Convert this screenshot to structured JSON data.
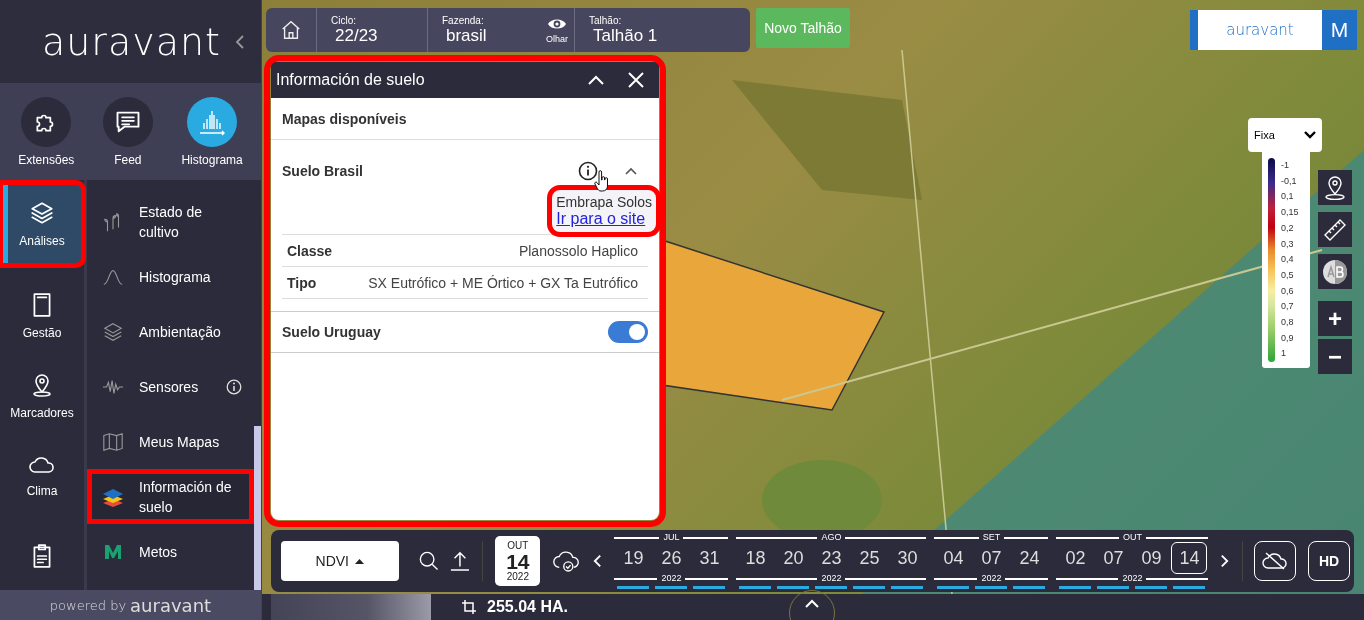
{
  "sidebar": {
    "logo": "auravant",
    "quick_actions": [
      {
        "label": "Extensões",
        "selected": false
      },
      {
        "label": "Feed",
        "selected": false
      },
      {
        "label": "Histograma",
        "selected": true
      }
    ],
    "nav": [
      {
        "label": "Análises",
        "selected": true,
        "highlighted": true
      },
      {
        "label": "Gestão",
        "selected": false,
        "highlighted": false
      },
      {
        "label": "Marcadores",
        "selected": false,
        "highlighted": false
      },
      {
        "label": "Clima",
        "selected": false,
        "highlighted": false
      },
      {
        "selected": false,
        "highlighted": false
      }
    ],
    "submenu": [
      {
        "label": "Estado de cultivo",
        "info": false,
        "highlighted": false
      },
      {
        "label": "Histograma",
        "info": false,
        "highlighted": false
      },
      {
        "label": "Ambientação",
        "info": false,
        "highlighted": false
      },
      {
        "label": "Sensores",
        "info": true,
        "highlighted": false
      },
      {
        "label": "Meus Mapas",
        "info": false,
        "highlighted": false
      },
      {
        "label": "Información de suelo",
        "info": false,
        "highlighted": true
      },
      {
        "label": "Metos",
        "info": false,
        "highlighted": false
      }
    ],
    "footer": {
      "prefix": "powered by",
      "brand": "auravant"
    }
  },
  "topbar": {
    "fields": [
      {
        "label": "Ciclo:",
        "value": "22/23"
      },
      {
        "label": "Fazenda:",
        "value": "brasil"
      },
      {
        "label": "Talhão:",
        "value": "Talhão 1"
      }
    ],
    "view_label": "Olhar",
    "new_button": "Novo Talhão",
    "brand": "auravant",
    "user_initial": "M"
  },
  "panel": {
    "title": "Información de suelo",
    "highlighted": true,
    "section_title": "Mapas disponíveis",
    "maps": [
      {
        "kind": "expandable",
        "name": "Suelo Brasil",
        "expanded": true,
        "tooltip": {
          "source": "Embrapa Solos",
          "link": "Ir para o site",
          "highlighted": true
        },
        "properties": [
          {
            "label": "Classe",
            "value": "Planossolo Haplico"
          },
          {
            "label": "Tipo",
            "value": "SX Eutrófico + ME Órtico + GX Ta Eutrófico"
          }
        ]
      },
      {
        "kind": "toggle",
        "name": "Suelo Uruguay",
        "on": true
      }
    ]
  },
  "legend": {
    "mode": "Fixa",
    "ticks": [
      "-1",
      "-0,1",
      "0,1",
      "0,15",
      "0,2",
      "0,3",
      "0,4",
      "0,5",
      "0,6",
      "0,7",
      "0,8",
      "0,9",
      "1"
    ]
  },
  "map_tools": {
    "zoom_in": "+",
    "zoom_out": "−"
  },
  "bottom_bar": {
    "index": "NDVI",
    "date": {
      "month": "OUT",
      "day": "14",
      "year": "2022"
    },
    "timeline": [
      {
        "month": "JUL",
        "year": "2022",
        "dates": [
          {
            "day": "19",
            "selected": false
          },
          {
            "day": "26",
            "selected": false
          },
          {
            "day": "31",
            "selected": false
          }
        ]
      },
      {
        "month": "AGO",
        "year": "2022",
        "dates": [
          {
            "day": "18",
            "selected": false
          },
          {
            "day": "20",
            "selected": false
          },
          {
            "day": "23",
            "selected": false
          },
          {
            "day": "25",
            "selected": false
          },
          {
            "day": "30",
            "selected": false
          }
        ]
      },
      {
        "month": "SET",
        "year": "2022",
        "dates": [
          {
            "day": "04",
            "selected": false
          },
          {
            "day": "07",
            "selected": false
          },
          {
            "day": "24",
            "selected": false
          }
        ]
      },
      {
        "month": "OUT",
        "year": "2022",
        "dates": [
          {
            "day": "02",
            "selected": false
          },
          {
            "day": "07",
            "selected": false
          },
          {
            "day": "09",
            "selected": false
          },
          {
            "day": "14",
            "selected": true
          }
        ]
      }
    ],
    "hd": "HD"
  },
  "status_bar": {
    "area": "255.04 HA."
  }
}
